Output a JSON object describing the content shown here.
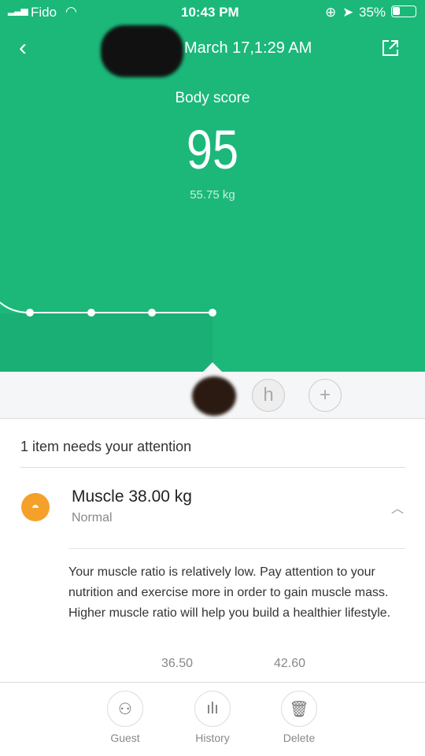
{
  "status_bar": {
    "carrier": "Fido",
    "time": "10:43 PM",
    "battery": "35%"
  },
  "header": {
    "title": "March 17,1:29 AM"
  },
  "score": {
    "label": "Body score",
    "value": "95",
    "weight": "55.75 kg"
  },
  "users": {
    "guest_initial": "h",
    "add": "+"
  },
  "attention": {
    "title": "1 item needs your attention"
  },
  "muscle": {
    "name": "Muscle",
    "value": "38.00 kg",
    "status": "Normal",
    "description": "Your muscle ratio is relatively low. Pay attention to your nutrition and exercise more in order to gain muscle mass. Higher muscle ratio will help you build a healthier lifestyle.",
    "range": [
      "36.50",
      "42.60"
    ]
  },
  "footer": {
    "guest": "Guest",
    "history": "History",
    "delete": "Delete"
  },
  "colors": {
    "accent": "#1bb87a",
    "muscle_icon": "#f5a02a"
  }
}
